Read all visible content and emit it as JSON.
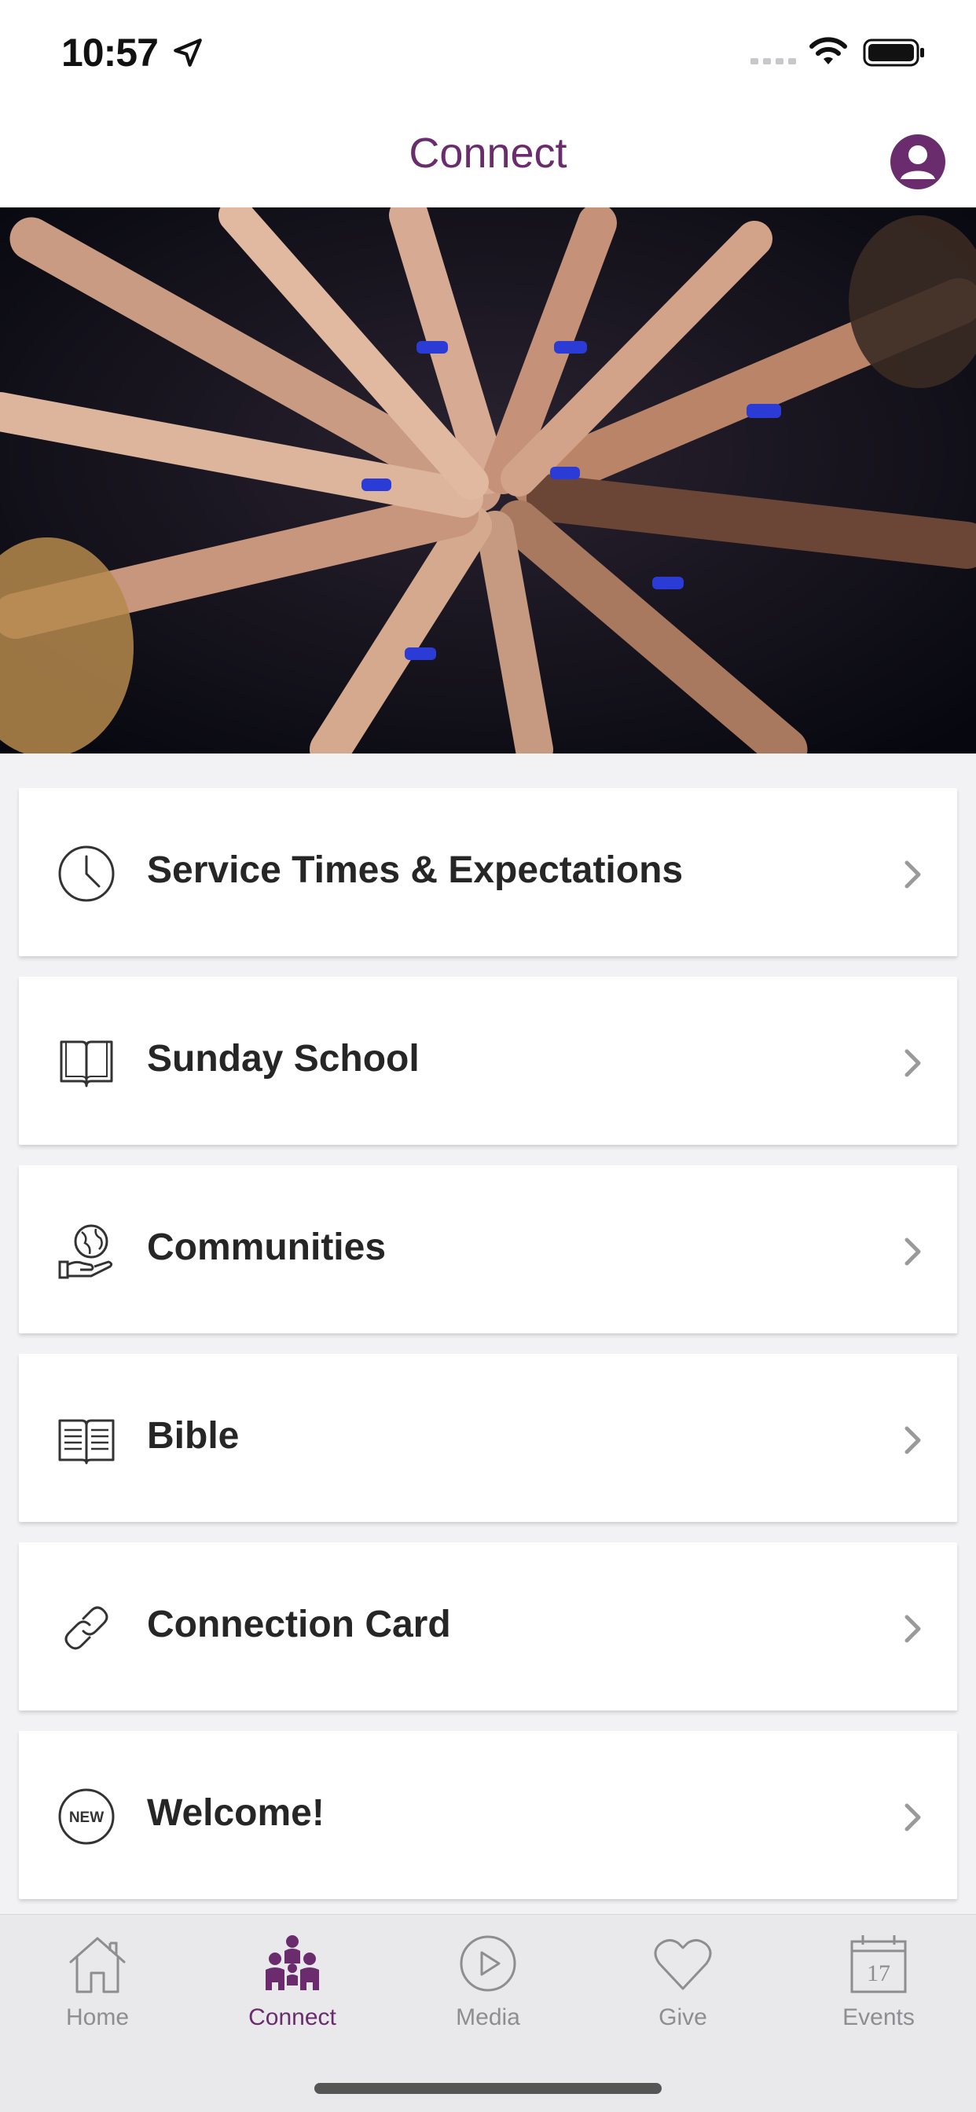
{
  "status_bar": {
    "time": "10:57",
    "icons": [
      "location-arrow-icon",
      "signal-icon",
      "wifi-icon",
      "battery-icon"
    ]
  },
  "nav": {
    "title": "Connect",
    "profile_icon": "person-icon"
  },
  "hero": {
    "description_icon": "photo-icon"
  },
  "menu": {
    "items": [
      {
        "label": "Service Times & Expectations",
        "icon": "clock-icon"
      },
      {
        "label": "Sunday School",
        "icon": "book-icon"
      },
      {
        "label": "Communities",
        "icon": "globe-hand-icon"
      },
      {
        "label": "Bible",
        "icon": "open-bible-icon"
      },
      {
        "label": "Connection Card",
        "icon": "link-icon"
      },
      {
        "label": "Welcome!",
        "icon": "new-badge-icon",
        "badge_text": "NEW"
      }
    ]
  },
  "tabs": [
    {
      "label": "Home",
      "icon": "home-icon",
      "active": false
    },
    {
      "label": "Connect",
      "icon": "people-icon",
      "active": true
    },
    {
      "label": "Media",
      "icon": "play-circle-icon",
      "active": false
    },
    {
      "label": "Give",
      "icon": "heart-icon",
      "active": false
    },
    {
      "label": "Events",
      "icon": "calendar-icon",
      "active": false,
      "calendar_day": "17"
    }
  ],
  "colors": {
    "accent": "#6b2c6e",
    "tab_inactive": "#8d8d92",
    "background": "#f2f2f4"
  }
}
